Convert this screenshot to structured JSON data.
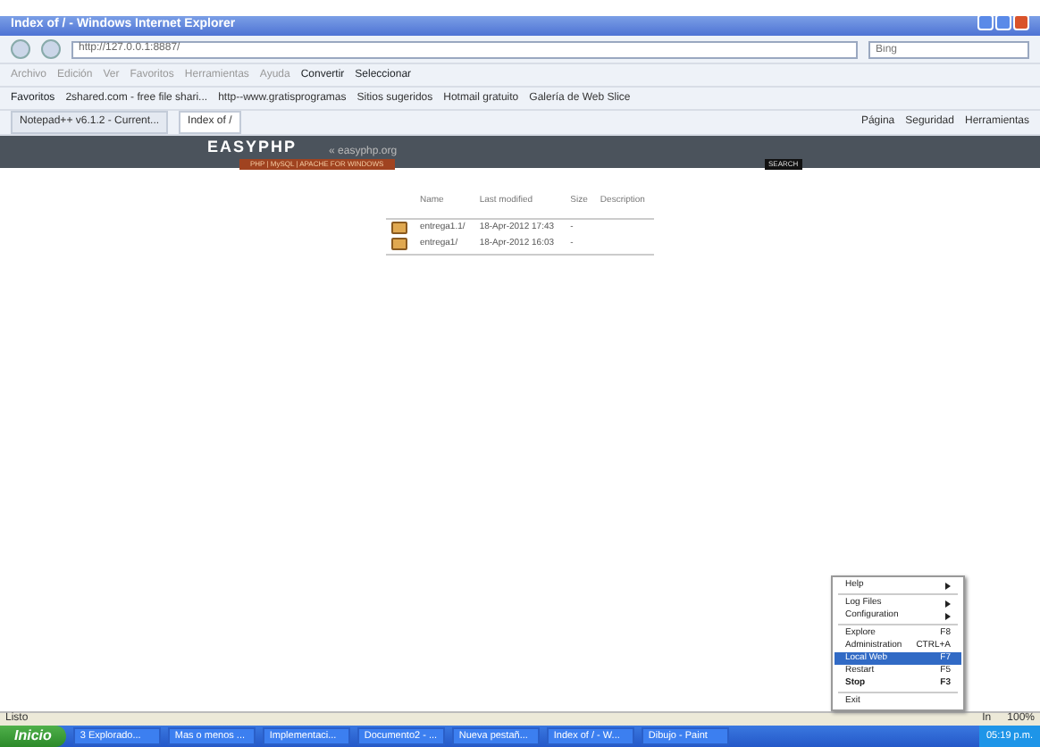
{
  "window": {
    "title": "Index of / - Windows Internet Explorer"
  },
  "address_bar": {
    "url": "http://127.0.0.1:8887/",
    "search_placeholder": "Bing"
  },
  "menu_bar": [
    "Archivo",
    "Edición",
    "Ver",
    "Favoritos",
    "Herramientas",
    "Ayuda"
  ],
  "toolbar": [
    "Convertir",
    "Seleccionar"
  ],
  "favorites_bar": [
    "Favoritos",
    "2shared.com - free file shari...",
    "http--www.gratisprogramas",
    "Sitios sugeridos",
    "Hotmail gratuito",
    "Galería de Web Slice"
  ],
  "tabs": [
    {
      "label": "Notepad++ v6.1.2 - Current...",
      "selected": false
    },
    {
      "label": "Index of /",
      "selected": true
    }
  ],
  "command_bar": [
    "Página",
    "Seguridad",
    "Herramientas"
  ],
  "site_header": {
    "logo": "EASYPHP",
    "tagline": "PHP | MySQL | APACHE FOR WINDOWS",
    "link": "« easyphp.org",
    "search": "SEARCH"
  },
  "listing": {
    "columns": [
      "Name",
      "Last modified",
      "Size",
      "Description"
    ],
    "rows": [
      {
        "name": "entrega1.1/",
        "modified": "18-Apr-2012 17:43",
        "size": "-"
      },
      {
        "name": "entrega1/",
        "modified": "18-Apr-2012 16:03",
        "size": "-"
      }
    ]
  },
  "context_menu": [
    {
      "kind": "item",
      "label": "Help",
      "submenu": true,
      "selected": false
    },
    {
      "kind": "separator"
    },
    {
      "kind": "item",
      "label": "Log Files",
      "submenu": true,
      "selected": false
    },
    {
      "kind": "item",
      "label": "Configuration",
      "submenu": true,
      "selected": false
    },
    {
      "kind": "separator"
    },
    {
      "kind": "item",
      "label": "Explore",
      "shortcut": "F8",
      "selected": false
    },
    {
      "kind": "item",
      "label": "Administration",
      "shortcut": "CTRL+A",
      "selected": false
    },
    {
      "kind": "item",
      "label": "Local Web",
      "shortcut": "F7",
      "selected": true
    },
    {
      "kind": "item",
      "label": "Restart",
      "shortcut": "F5",
      "selected": false
    },
    {
      "kind": "item",
      "label": "Stop",
      "shortcut": "F3",
      "bold": true,
      "selected": false
    },
    {
      "kind": "separator"
    },
    {
      "kind": "item",
      "label": "Exit",
      "selected": false
    }
  ],
  "status_bar": {
    "text": "Listo",
    "zone": "In",
    "zoom": "100%"
  },
  "taskbar": {
    "start": "Inicio",
    "items": [
      "3 Explorado...",
      "Mas o menos ...",
      "Implementaci...",
      "Documento2 - ...",
      "Nueva pestañ...",
      "Index of / - W...",
      "Dibujo - Paint"
    ],
    "clock": "05:19 p.m."
  }
}
